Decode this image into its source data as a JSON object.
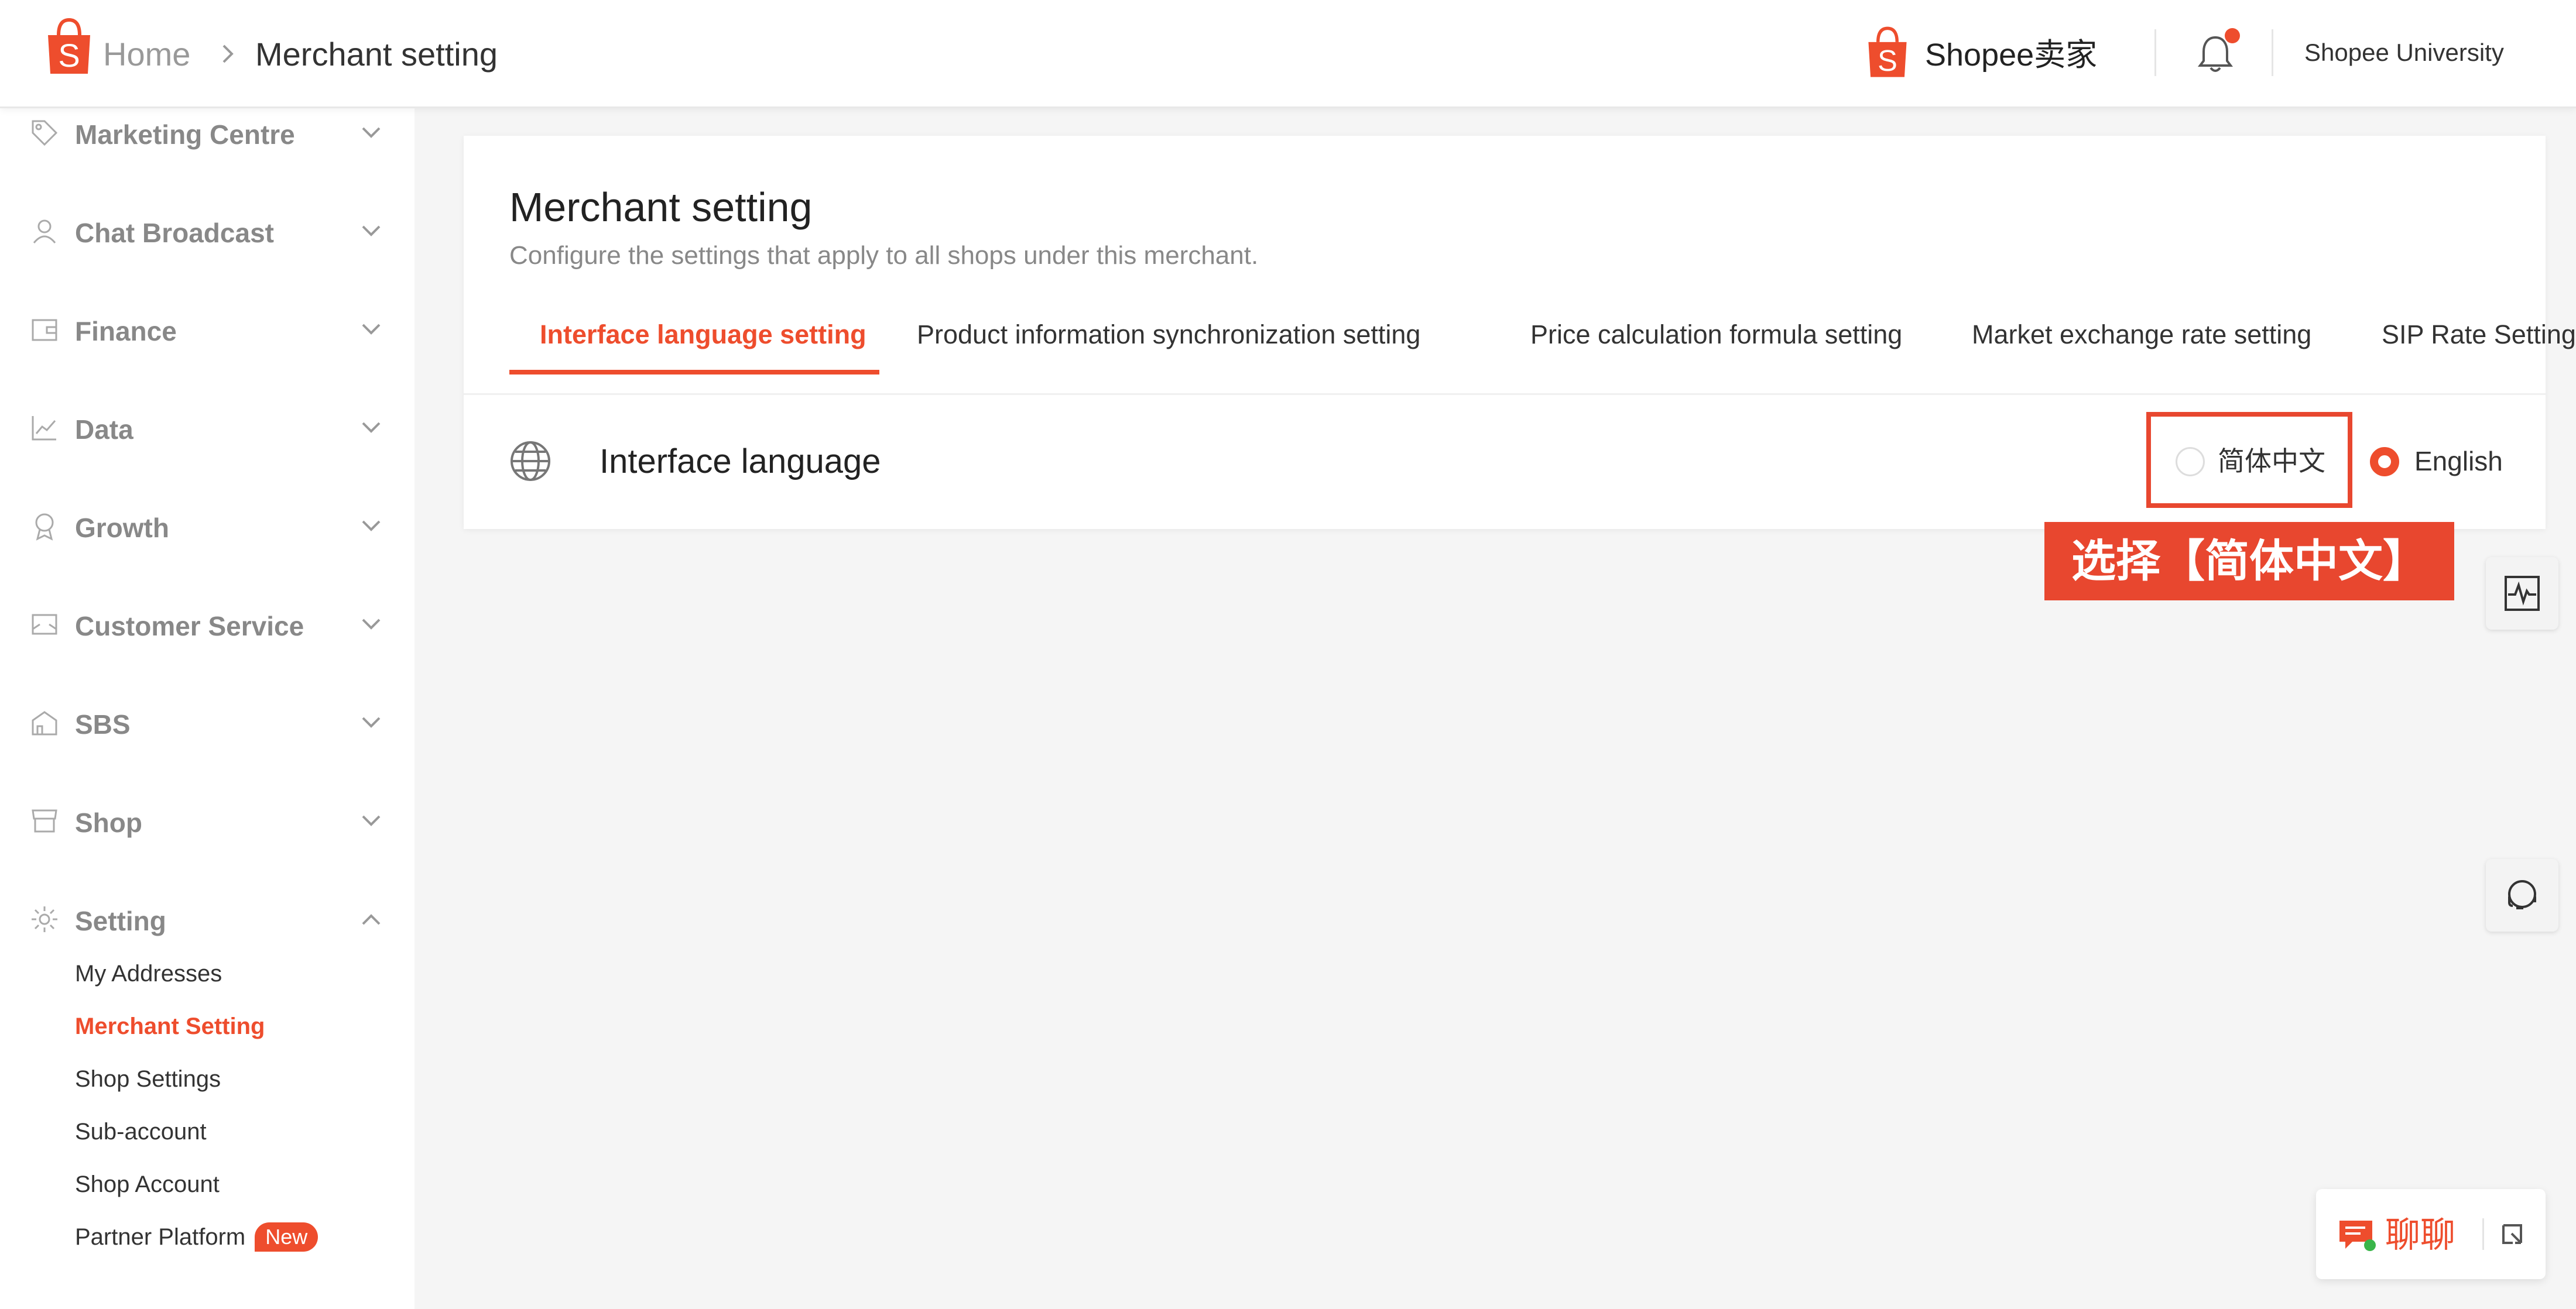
{
  "header": {
    "breadcrumb_home": "Home",
    "breadcrumb_current": "Merchant setting",
    "brand_name": "Shopee卖家",
    "university_link": "Shopee University",
    "logo_letter": "S"
  },
  "sidebar": {
    "groups": [
      {
        "label": "Marketing Centre",
        "icon": "tag-icon"
      },
      {
        "label": "Chat Broadcast",
        "icon": "user-icon"
      },
      {
        "label": "Finance",
        "icon": "wallet-icon"
      },
      {
        "label": "Data",
        "icon": "chart-icon"
      },
      {
        "label": "Growth",
        "icon": "medal-icon"
      },
      {
        "label": "Customer Service",
        "icon": "mail-icon"
      },
      {
        "label": "SBS",
        "icon": "warehouse-icon"
      },
      {
        "label": "Shop",
        "icon": "shop-icon"
      },
      {
        "label": "Setting",
        "icon": "gear-icon"
      }
    ],
    "setting_items": [
      {
        "label": "My Addresses"
      },
      {
        "label": "Merchant Setting"
      },
      {
        "label": "Shop Settings"
      },
      {
        "label": "Sub-account"
      },
      {
        "label": "Shop Account"
      },
      {
        "label": "Partner Platform",
        "badge": "New"
      }
    ]
  },
  "main": {
    "title": "Merchant setting",
    "description": "Configure the settings that apply to all shops under this merchant.",
    "tabs": [
      {
        "label": "Interface language setting"
      },
      {
        "label": "Product information synchronization setting"
      },
      {
        "label": "Price calculation formula setting"
      },
      {
        "label": "Market exchange rate setting"
      },
      {
        "label": "SIP Rate Setting"
      }
    ],
    "language_row": {
      "label": "Interface language",
      "options": [
        {
          "label": "简体中文",
          "selected": false
        },
        {
          "label": "English",
          "selected": true
        }
      ]
    }
  },
  "annotation": {
    "text": "选择【简体中文】"
  },
  "chat": {
    "label": "聊聊"
  },
  "colors": {
    "accent": "#ee4d2d",
    "annotation": "#e8472f",
    "background": "#f5f5f5"
  }
}
